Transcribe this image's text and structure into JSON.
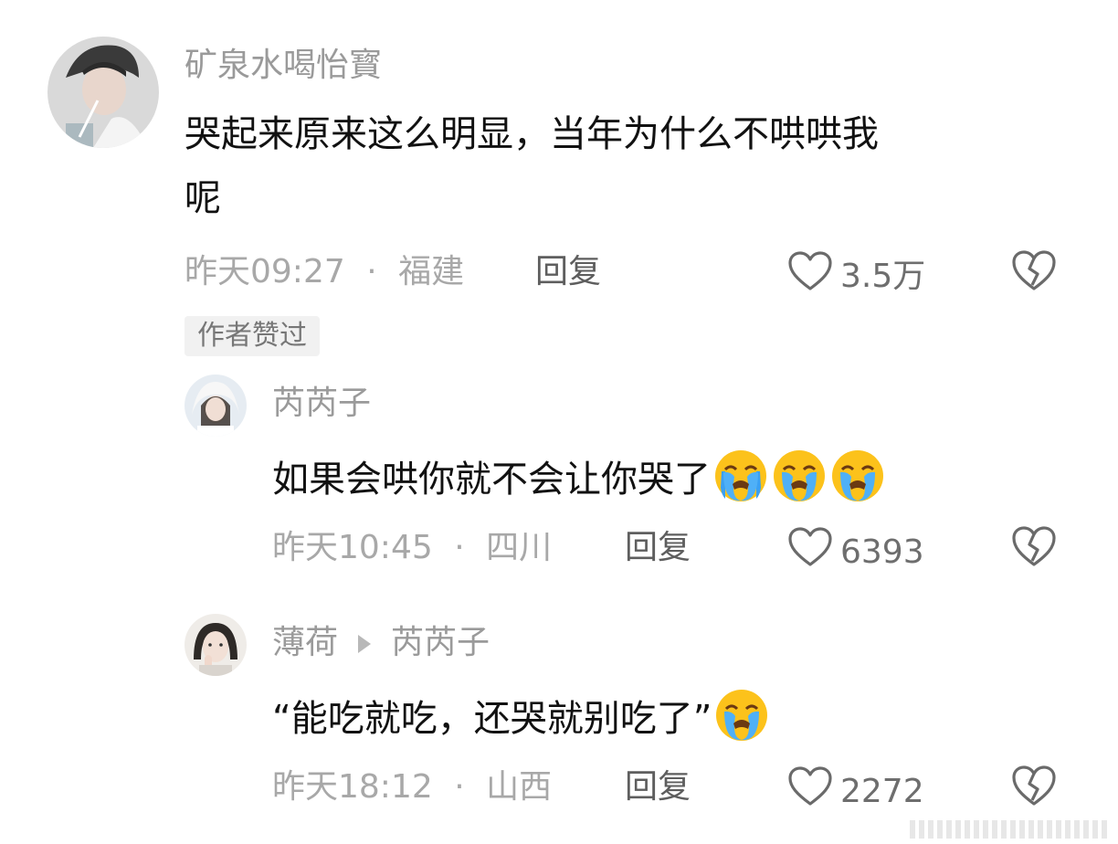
{
  "comments": [
    {
      "username": "矿泉水喝怡寳",
      "text_line1": "哭起来原来这么明显，当年为什么不哄哄我",
      "text_line2": "呢",
      "time": "昨天09:27",
      "location": "福建",
      "reply_label": "回复",
      "likes": "3.5万",
      "badge": "作者赞过"
    },
    {
      "username": "芮芮子",
      "text": "如果会哄你就不会让你哭了",
      "time": "昨天10:45",
      "location": "四川",
      "reply_label": "回复",
      "likes": "6393"
    },
    {
      "username": "薄荷",
      "reply_to": "芮芮子",
      "text": "“能吃就吃，还哭就别吃了”",
      "time": "昨天18:12",
      "location": "山西",
      "reply_label": "回复",
      "likes": "2272"
    }
  ],
  "separator": "·",
  "icons": {
    "like": "heart-outline-icon",
    "dislike": "broken-heart-icon",
    "emoji": "loudly-crying-face-emoji"
  },
  "colors": {
    "username": "#9a9a9a",
    "text": "#111111",
    "meta": "#a8a8a8",
    "badge_bg": "#f1f1f1"
  }
}
